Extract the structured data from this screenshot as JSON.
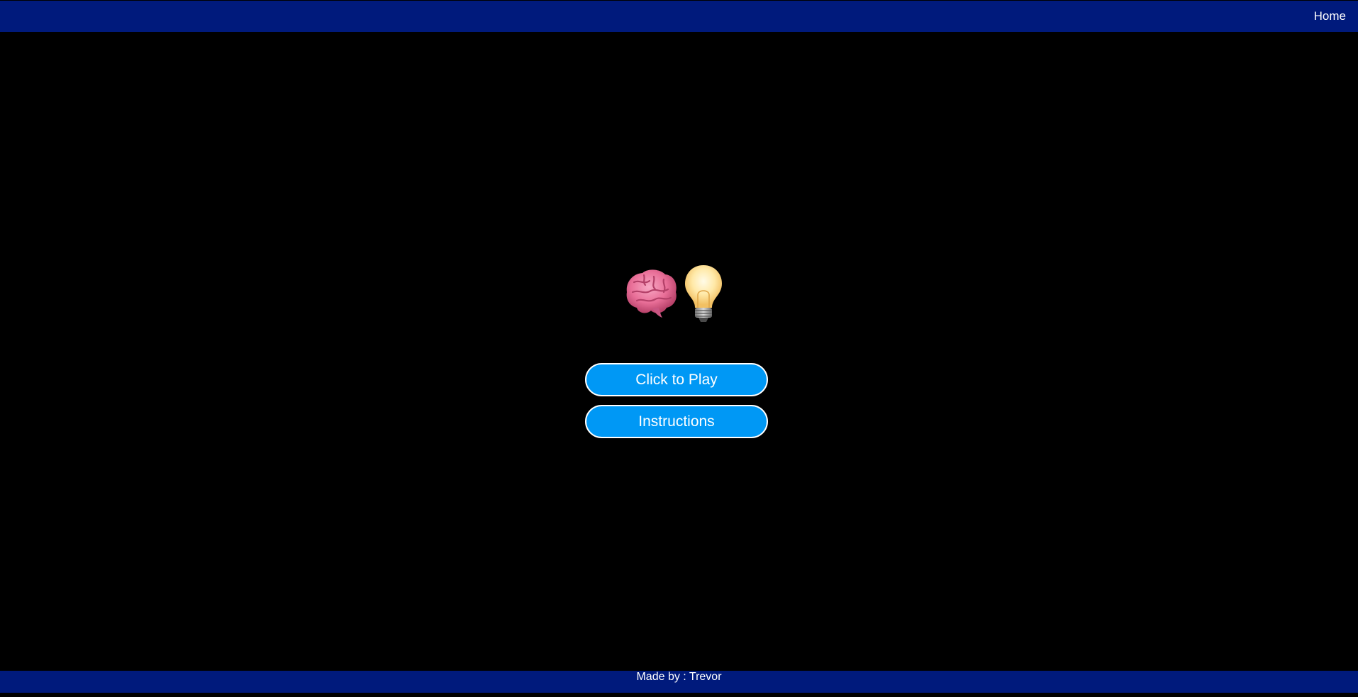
{
  "nav": {
    "home_label": "Home"
  },
  "hero": {
    "icons": [
      "brain-icon",
      "lightbulb-icon"
    ]
  },
  "menu": {
    "play_label": "Click to Play",
    "instructions_label": "Instructions"
  },
  "footer": {
    "credit": "Made by : Trevor"
  },
  "colors": {
    "background": "#000000",
    "nav_bar": "#001a7c",
    "button_fill": "#0098f5",
    "button_border": "#ffffff",
    "text": "#ffffff"
  }
}
